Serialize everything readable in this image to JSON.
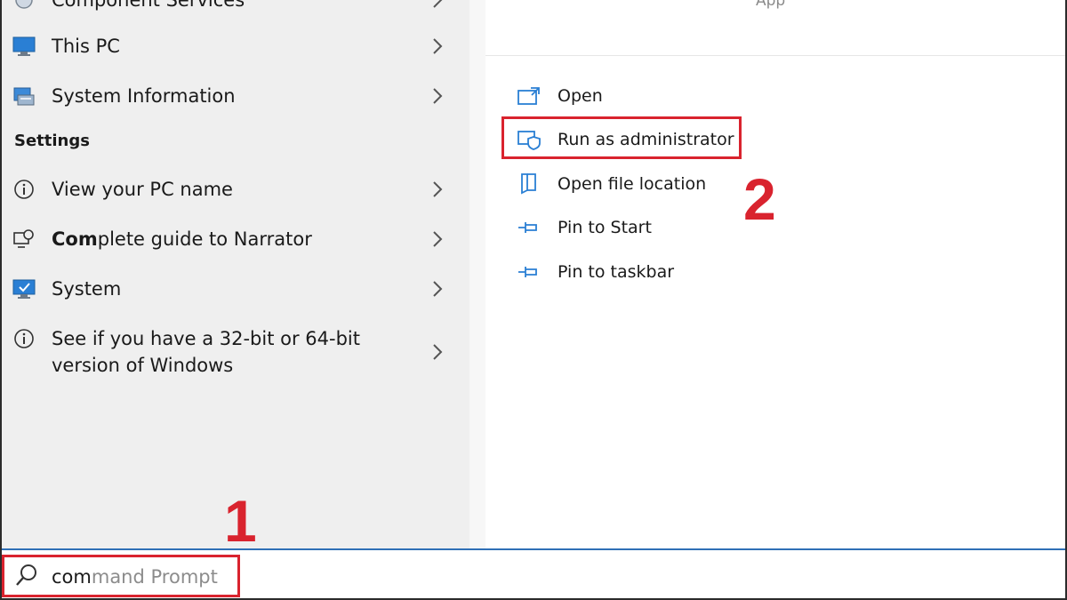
{
  "right_panel": {
    "app_label": "App"
  },
  "results": [
    {
      "label": "Component Services",
      "icon": "component-services-icon"
    },
    {
      "label": "This PC",
      "icon": "monitor-icon"
    },
    {
      "label": "System Information",
      "icon": "system-information-icon"
    }
  ],
  "settings": {
    "heading": "Settings",
    "items": [
      {
        "label": "View your PC name",
        "icon": "info-icon"
      },
      {
        "label_bold": "Com",
        "label_rest": "plete guide to Narrator",
        "icon": "narrator-icon"
      },
      {
        "label": "System",
        "icon": "system-monitor-icon"
      },
      {
        "label": "See if you have a 32-bit or 64-bit version of Windows",
        "icon": "info-icon"
      }
    ]
  },
  "actions": [
    {
      "label": "Open",
      "icon": "open-icon"
    },
    {
      "label": "Run as administrator",
      "icon": "shield-icon"
    },
    {
      "label": "Open file location",
      "icon": "folder-icon"
    },
    {
      "label": "Pin to Start",
      "icon": "pin-icon"
    },
    {
      "label": "Pin to taskbar",
      "icon": "pin-icon"
    }
  ],
  "annotations": {
    "step1": "1",
    "step2": "2"
  },
  "search": {
    "typed": "com",
    "suggestion": "mand Prompt"
  },
  "colors": {
    "accent": "#2f6fb6",
    "highlight": "#d9232e",
    "icon_blue": "#2a7fd4"
  }
}
